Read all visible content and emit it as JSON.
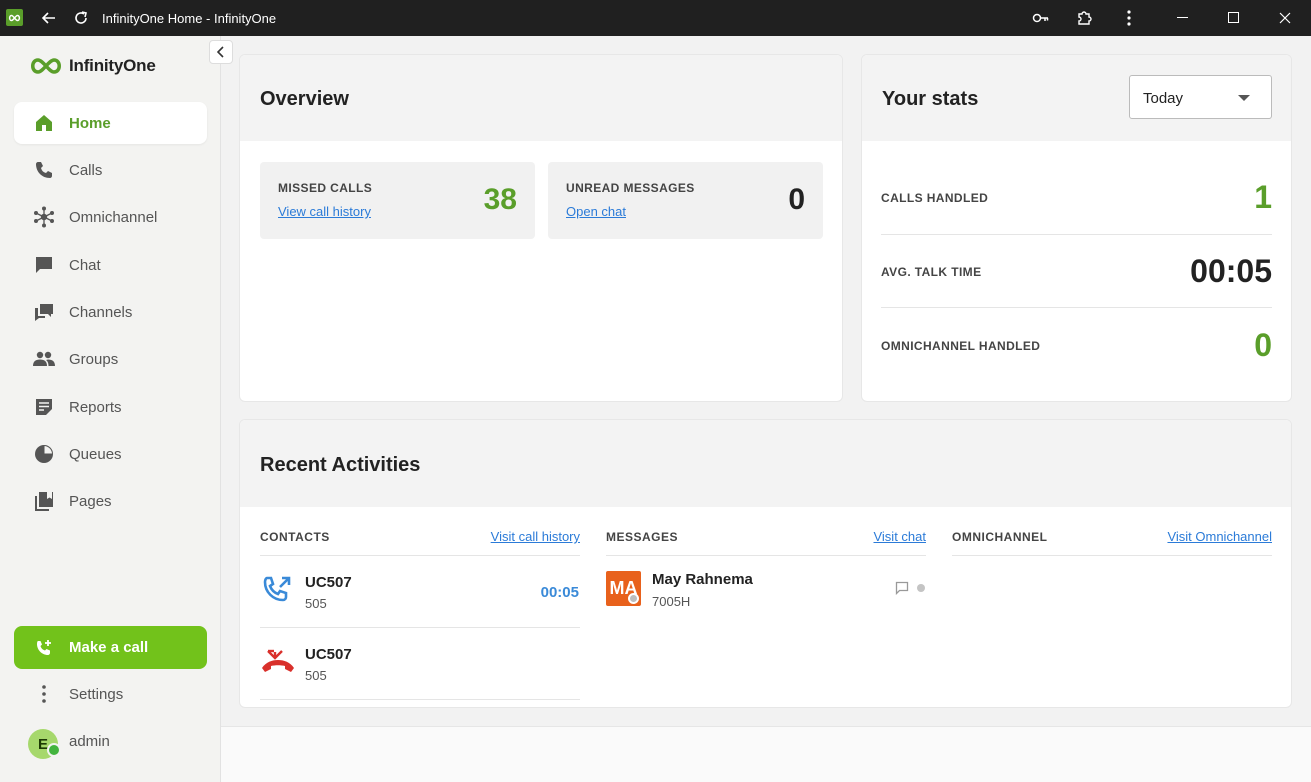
{
  "window": {
    "title": "InfinityOne Home - InfinityOne"
  },
  "sidebar": {
    "logo_text": "InfinityOne",
    "items": [
      {
        "label": "Home",
        "icon": "home-icon"
      },
      {
        "label": "Calls",
        "icon": "phone-icon"
      },
      {
        "label": "Omnichannel",
        "icon": "omnichannel-icon"
      },
      {
        "label": "Chat",
        "icon": "chat-icon"
      },
      {
        "label": "Channels",
        "icon": "channels-icon"
      },
      {
        "label": "Groups",
        "icon": "groups-icon"
      },
      {
        "label": "Reports",
        "icon": "reports-icon"
      },
      {
        "label": "Queues",
        "icon": "queues-icon"
      },
      {
        "label": "Pages",
        "icon": "pages-icon"
      }
    ],
    "make_call_label": "Make a call",
    "settings_label": "Settings",
    "user": {
      "initial": "E",
      "name": "admin"
    }
  },
  "overview": {
    "title": "Overview",
    "missed_calls": {
      "label": "MISSED CALLS",
      "link": "View call history",
      "value": "38"
    },
    "unread_messages": {
      "label": "UNREAD MESSAGES",
      "link": "Open chat",
      "value": "0"
    }
  },
  "stats": {
    "title": "Your stats",
    "period": "Today",
    "rows": [
      {
        "label": "CALLS HANDLED",
        "value": "1"
      },
      {
        "label": "AVG. TALK TIME",
        "value": "00:05"
      },
      {
        "label": "OMNICHANNEL HANDLED",
        "value": "0"
      }
    ]
  },
  "recent": {
    "title": "Recent Activities",
    "contacts": {
      "heading": "CONTACTS",
      "link": "Visit call history",
      "items": [
        {
          "name": "UC507",
          "number": "505",
          "duration": "00:05",
          "type": "outgoing"
        },
        {
          "name": "UC507",
          "number": "505",
          "duration": "",
          "type": "missed"
        }
      ]
    },
    "messages": {
      "heading": "MESSAGES",
      "link": "Visit chat",
      "items": [
        {
          "initials": "MA",
          "name": "May Rahnema",
          "sub": "7005H"
        }
      ]
    },
    "omnichannel": {
      "heading": "OMNICHANNEL",
      "link": "Visit Omnichannel"
    }
  },
  "colors": {
    "accent_green": "#72c21b",
    "value_green": "#5a9e2a",
    "link_blue": "#2b7bd8",
    "missed_red": "#d9302b"
  }
}
